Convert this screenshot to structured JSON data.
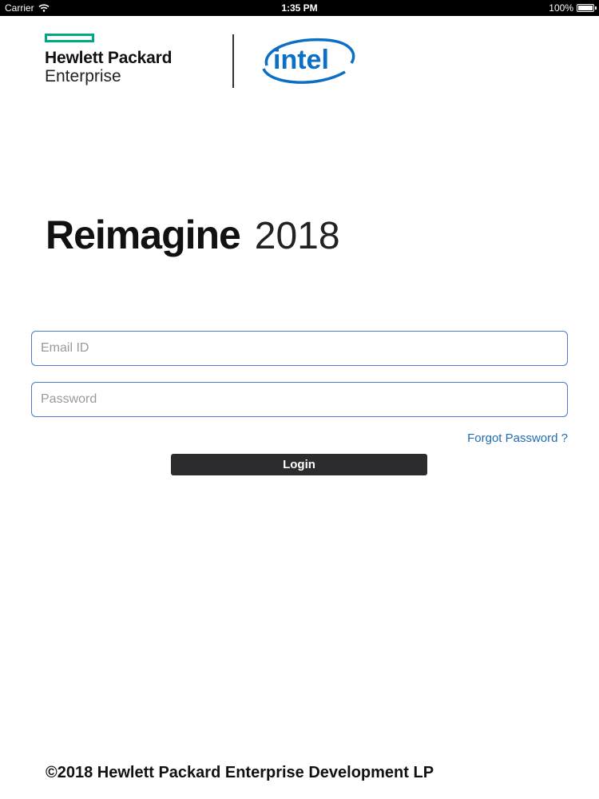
{
  "status_bar": {
    "carrier": "Carrier",
    "time": "1:35 PM",
    "battery": "100%",
    "icons": [
      "wifi-icon",
      "battery-icon"
    ]
  },
  "logos": {
    "hpe_line1": "Hewlett Packard",
    "hpe_line2": "Enterprise",
    "intel_text": "intel",
    "hpe_color": "#01a982",
    "intel_color": "#0b6fc6"
  },
  "hero": {
    "title_bold": "Reimagine",
    "title_light": "2018"
  },
  "form": {
    "email_placeholder": "Email ID",
    "email_value": "",
    "password_placeholder": "Password",
    "password_value": "",
    "forgot_password": "Forgot Password ?",
    "login_label": "Login",
    "field_border_color": "#4a7bd0",
    "link_color": "#1f6db2",
    "button_color": "#2c2c2e"
  },
  "footer": {
    "copyright": "©2018 Hewlett Packard Enterprise Development LP"
  }
}
